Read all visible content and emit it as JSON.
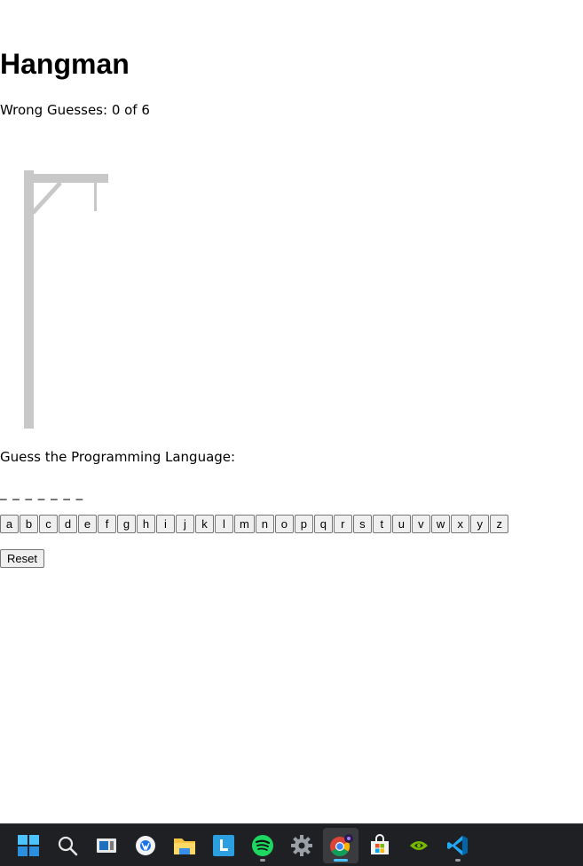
{
  "page": {
    "title": "Hangman",
    "wrong_guesses": "Wrong Guesses: 0 of 6",
    "prompt": "Guess the Programming Language:",
    "word_blanks": "_ _ _ _ _ _ _",
    "letters": [
      "a",
      "b",
      "c",
      "d",
      "e",
      "f",
      "g",
      "h",
      "i",
      "j",
      "k",
      "l",
      "m",
      "n",
      "o",
      "p",
      "q",
      "r",
      "s",
      "t",
      "u",
      "v",
      "w",
      "x",
      "y",
      "z"
    ],
    "reset_label": "Reset"
  },
  "colors": {
    "gallows": "#c8c8c8",
    "taskbar_bg": "#1f2023",
    "active_indicator": "#4cc2ff"
  },
  "taskbar": {
    "items": [
      {
        "icon": "windows-start-icon"
      },
      {
        "icon": "search-icon"
      },
      {
        "icon": "task-view-icon"
      },
      {
        "icon": "widgets-app-icon"
      },
      {
        "icon": "file-explorer-icon"
      },
      {
        "icon": "l-app-icon"
      },
      {
        "icon": "spotify-icon"
      },
      {
        "icon": "settings-gear-icon"
      },
      {
        "icon": "chrome-icon"
      },
      {
        "icon": "microsoft-store-icon"
      },
      {
        "icon": "nvidia-icon"
      },
      {
        "icon": "vscode-icon"
      }
    ]
  }
}
